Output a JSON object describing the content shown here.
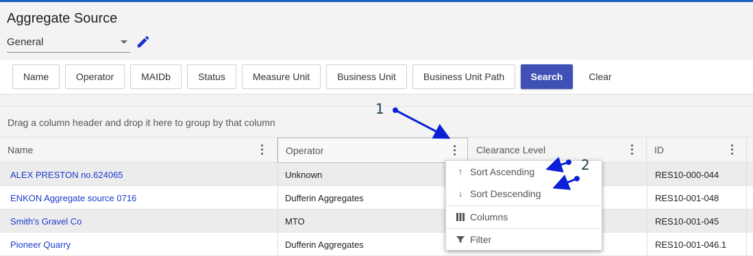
{
  "page": {
    "title": "Aggregate Source"
  },
  "view_select": {
    "value": "General"
  },
  "filters": {
    "buttons": [
      "Name",
      "Operator",
      "MAIDb",
      "Status",
      "Measure Unit",
      "Business Unit",
      "Business Unit Path"
    ],
    "search_label": "Search",
    "clear_label": "Clear"
  },
  "group_panel": {
    "text": "Drag a column header and drop it here to group by that column"
  },
  "grid": {
    "columns": [
      "Name",
      "Operator",
      "Clearance Level",
      "ID"
    ],
    "rows": [
      {
        "name": "ALEX PRESTON no.624065",
        "operator": "Unknown",
        "id": "RES10-000-044"
      },
      {
        "name": "ENKON Aggregate source 0716",
        "operator": "Dufferin Aggregates",
        "id": "RES10-001-048"
      },
      {
        "name": "Smith's Gravel Co",
        "operator": "MTO",
        "id": "RES10-001-045"
      },
      {
        "name": "Pioneer Quarry",
        "operator": "Dufferin Aggregates",
        "id": "RES10-001-046.1"
      }
    ]
  },
  "column_menu": {
    "items": [
      "Sort Ascending",
      "Sort Descending",
      "Columns",
      "Filter"
    ]
  },
  "annotations": {
    "label_1": "1",
    "label_2": "2"
  },
  "colors": {
    "accent": "#3f51b5",
    "topbar": "#1565c0",
    "link": "#1a3bcc",
    "arrow": "#0a1fd6"
  }
}
